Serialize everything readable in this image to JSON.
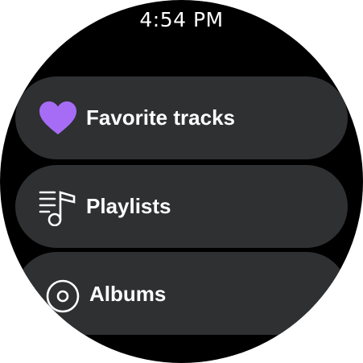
{
  "status": {
    "time": "4:54 PM"
  },
  "menu": {
    "items": [
      {
        "label": "Favorite tracks",
        "icon": "heart-icon",
        "icon_color": "#a66cf6"
      },
      {
        "label": "Playlists",
        "icon": "playlist-icon",
        "icon_color": "#ffffff"
      },
      {
        "label": "Albums",
        "icon": "album-disc-icon",
        "icon_color": "#ffffff"
      }
    ]
  },
  "colors": {
    "background": "#000000",
    "chip": "#2f3032",
    "text": "#ffffff",
    "accent": "#a66cf6"
  }
}
